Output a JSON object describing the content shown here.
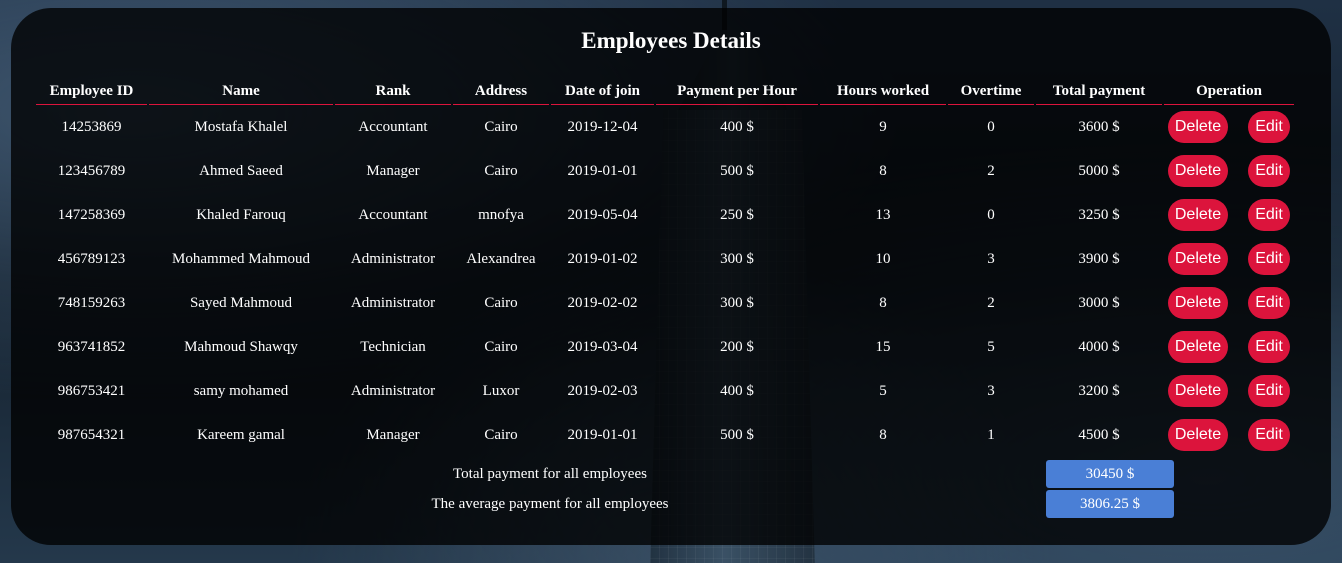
{
  "page": {
    "title": "Employees Details"
  },
  "table": {
    "headers": [
      "Employee ID",
      "Name",
      "Rank",
      "Address",
      "Date of join",
      "Payment per Hour",
      "Hours worked",
      "Overtime",
      "Total payment",
      "Operation"
    ],
    "rows": [
      {
        "id": "14253869",
        "name": "Mostafa Khalel",
        "rank": "Accountant",
        "address": "Cairo",
        "date": "2019-12-04",
        "pay": "400 $",
        "hours": "9",
        "overtime": "0",
        "total": "3600 $"
      },
      {
        "id": "123456789",
        "name": "Ahmed Saeed",
        "rank": "Manager",
        "address": "Cairo",
        "date": "2019-01-01",
        "pay": "500 $",
        "hours": "8",
        "overtime": "2",
        "total": "5000 $"
      },
      {
        "id": "147258369",
        "name": "Khaled Farouq",
        "rank": "Accountant",
        "address": "mnofya",
        "date": "2019-05-04",
        "pay": "250 $",
        "hours": "13",
        "overtime": "0",
        "total": "3250 $"
      },
      {
        "id": "456789123",
        "name": "Mohammed Mahmoud",
        "rank": "Administrator",
        "address": "Alexandrea",
        "date": "2019-01-02",
        "pay": "300 $",
        "hours": "10",
        "overtime": "3",
        "total": "3900 $"
      },
      {
        "id": "748159263",
        "name": "Sayed Mahmoud",
        "rank": "Administrator",
        "address": "Cairo",
        "date": "2019-02-02",
        "pay": "300 $",
        "hours": "8",
        "overtime": "2",
        "total": "3000 $"
      },
      {
        "id": "963741852",
        "name": "Mahmoud Shawqy",
        "rank": "Technician",
        "address": "Cairo",
        "date": "2019-03-04",
        "pay": "200 $",
        "hours": "15",
        "overtime": "5",
        "total": "4000 $"
      },
      {
        "id": "986753421",
        "name": "samy mohamed",
        "rank": "Administrator",
        "address": "Luxor",
        "date": "2019-02-03",
        "pay": "400 $",
        "hours": "5",
        "overtime": "3",
        "total": "3200 $"
      },
      {
        "id": "987654321",
        "name": "Kareem gamal",
        "rank": "Manager",
        "address": "Cairo",
        "date": "2019-01-01",
        "pay": "500 $",
        "hours": "8",
        "overtime": "1",
        "total": "4500 $"
      }
    ],
    "delete_label": "Delete",
    "edit_label": "Edit"
  },
  "summary": {
    "total_label": "Total payment for all employees",
    "total_value": "30450 $",
    "average_label": "The average payment for all employees",
    "average_value": "3806.25 $"
  },
  "colors": {
    "accent_red": "#dc143c",
    "summary_blue": "#4a7fd6"
  }
}
